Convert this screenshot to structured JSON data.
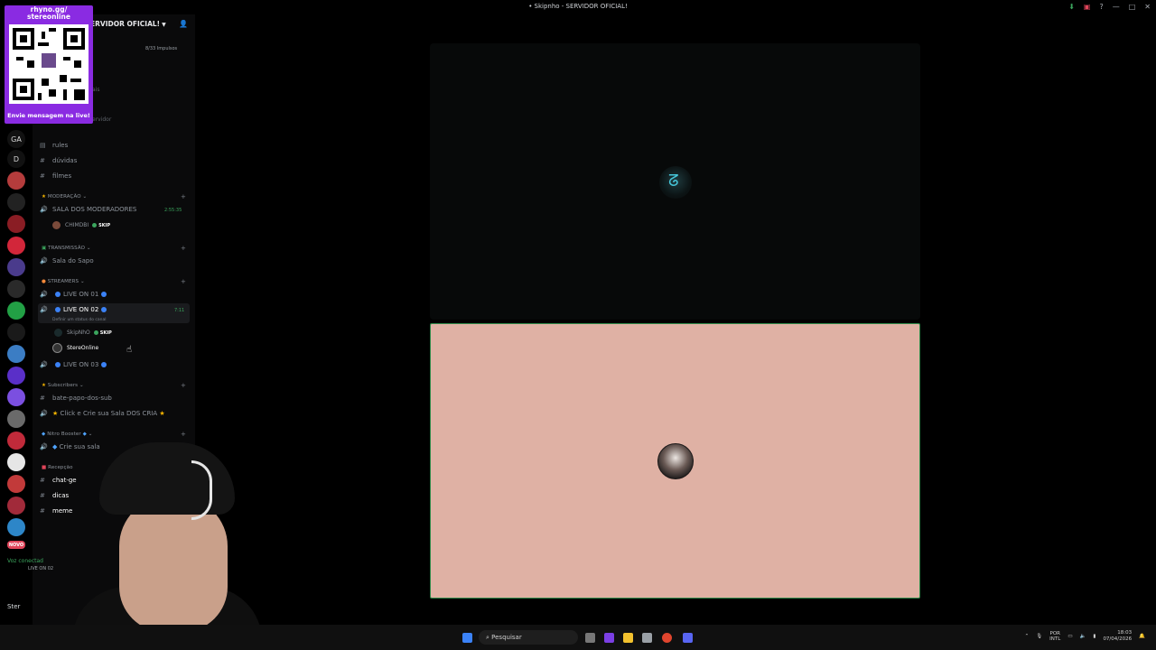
{
  "window": {
    "title": "• Skipnho - SERVIDOR OFICIAL!"
  },
  "overlay": {
    "qr_title": "rhyno.gg/\nstereonline",
    "qr_footer": "Envie mensagem na live!"
  },
  "server": {
    "name": "ERVIDOR OFICIAL!",
    "boosts": "8/33 Impulsos",
    "hint1": "ais",
    "hint2": "ervidor"
  },
  "server_rail": {
    "letter_icon": "D",
    "novo_badge": "NOVO"
  },
  "channels": {
    "rules": "rules",
    "duvidas": "dúvidas",
    "filmes": "filmes",
    "moderacao_cat": "MODERAÇÃO",
    "sala_mods": "SALA DOS MODERADORES",
    "sala_mods_time": "2:55:35",
    "mod_user": "CHIMDBI",
    "skip_label": "SKIP",
    "transmissao_cat": "TRANSMISSÃO",
    "sala_sapo": "Sala do Sapo",
    "streamers_cat": "STREAMERS",
    "live1": "LIVE ON 01",
    "live2": "LIVE ON 02",
    "live2_time": "7:11",
    "live2_status": "Definir um status do canal",
    "live2_user1": "SkipNhO",
    "live2_user2": "StereOnline",
    "live3": "LIVE ON 03",
    "subs_cat": "Subscribers",
    "bate_papo": "bate-papo-dos-sub",
    "click_crie": "Click e Crie sua Sala DOS CRIA",
    "nitro_cat": "Nitro Booster",
    "crie_sala": "Crie sua sala",
    "recepcao_cat": "Recepção",
    "chat_ge": "chat-ge",
    "dicas": "dicas",
    "meme": "meme"
  },
  "voice": {
    "connected": "Voz conectad",
    "channel": "LIVE ON 02"
  },
  "user_panel": {
    "name": "Ster"
  },
  "taskbar": {
    "search": "Pesquisar",
    "lang1": "POR",
    "lang2": "INTL",
    "time": "18:03",
    "date": "07/04/2026"
  }
}
